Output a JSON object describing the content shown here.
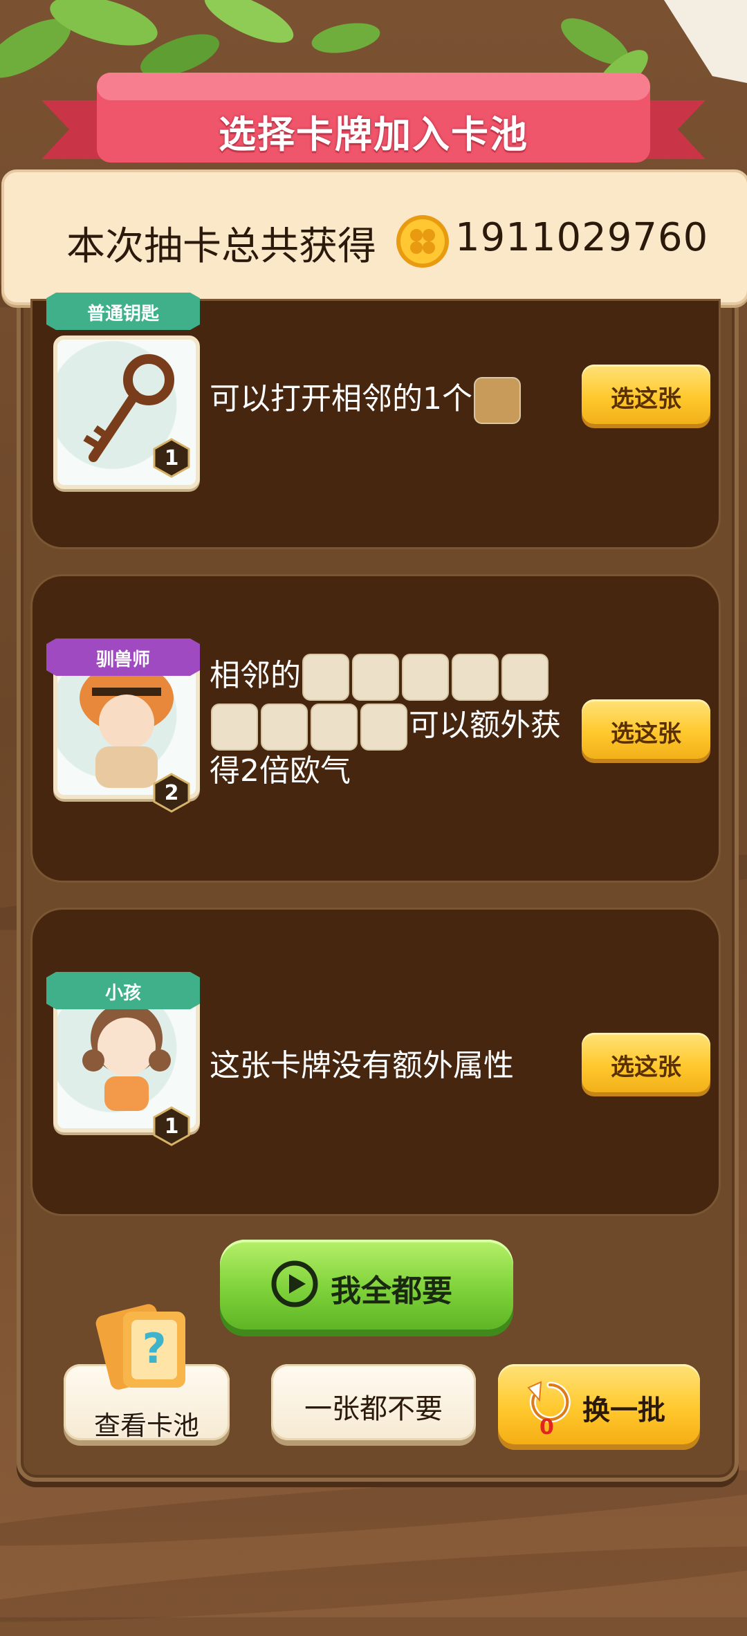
{
  "header": {
    "title": "选择卡牌加入卡池"
  },
  "total": {
    "label": "本次抽卡总共获得",
    "amount": "1911029760",
    "coin_icon": "clover-coin-icon"
  },
  "cards": [
    {
      "name": "普通钥匙",
      "level": "1",
      "description": "可以打开相邻的1个",
      "pick_label": "选这张",
      "ribbon_color": "#3fb08a"
    },
    {
      "name": "驯兽师",
      "level": "2",
      "description_prefix": "相邻的",
      "description_suffix": "可以额外获",
      "description_line3": "得2倍欧气",
      "pick_label": "选这张",
      "ribbon_color": "#a04ac2"
    },
    {
      "name": "小孩",
      "level": "1",
      "description": "这张卡牌没有额外属性",
      "pick_label": "选这张",
      "ribbon_color": "#3fb08a"
    }
  ],
  "actions": {
    "take_all": "我全都要",
    "view_pool": "查看卡池",
    "take_none": "一张都不要",
    "refresh": "换一批",
    "refresh_count": "0"
  }
}
